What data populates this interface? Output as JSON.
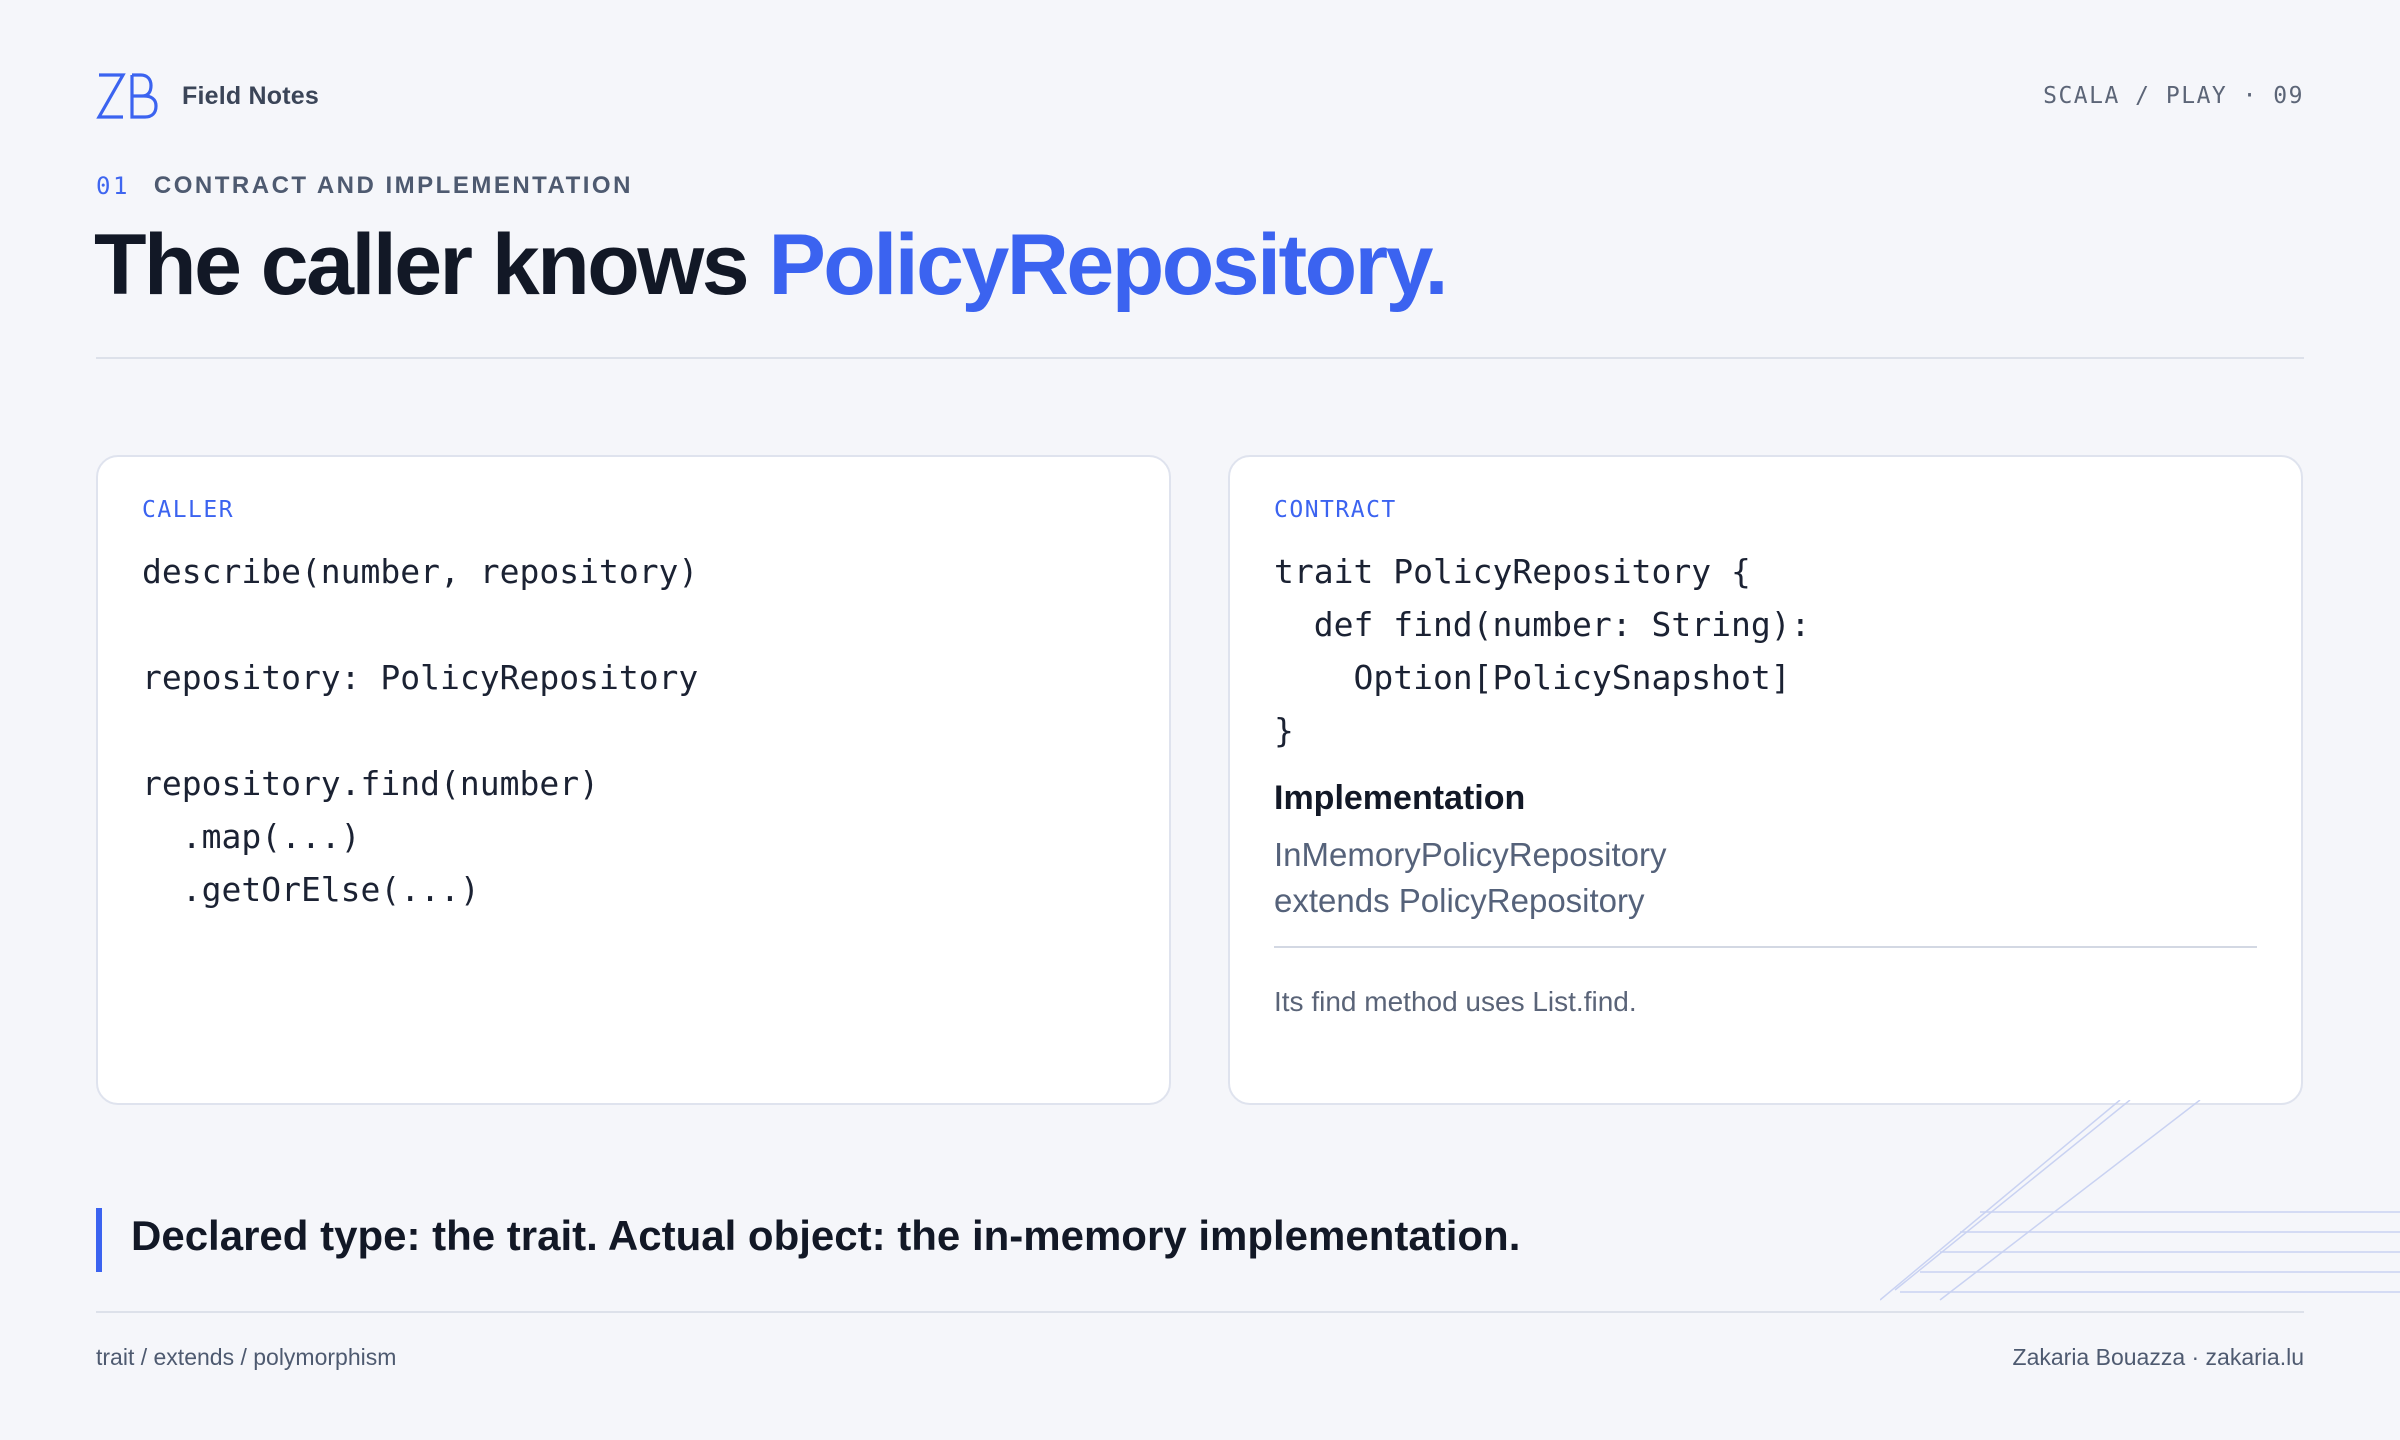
{
  "header": {
    "logo_icon": "zb-monogram-icon",
    "brand": "Field Notes",
    "breadcrumb": "SCALA / PLAY · 09"
  },
  "section": {
    "number": "01",
    "label": "CONTRACT AND IMPLEMENTATION"
  },
  "title": {
    "main": "The caller knows ",
    "accent": "PolicyRepository."
  },
  "caller_card": {
    "label": "CALLER",
    "code": "describe(number, repository)\n\nrepository: PolicyRepository\n\nrepository.find(number)\n  .map(...)\n  .getOrElse(...)"
  },
  "contract_card": {
    "label": "CONTRACT",
    "code": "trait PolicyRepository {\n  def find(number: String):\n    Option[PolicySnapshot]\n}",
    "implementation_title": "Implementation",
    "implementation_line1": "InMemoryPolicyRepository",
    "implementation_line2": "extends PolicyRepository",
    "note": "Its find method uses List.find."
  },
  "quote": "Declared type: the trait. Actual object: the in-memory implementation.",
  "footer": {
    "tags": "trait / extends / polymorphism",
    "author": "Zakaria Bouazza · zakaria.lu"
  },
  "colors": {
    "accent": "#3b63f0",
    "background": "#f5f6fa",
    "text": "#121826"
  }
}
